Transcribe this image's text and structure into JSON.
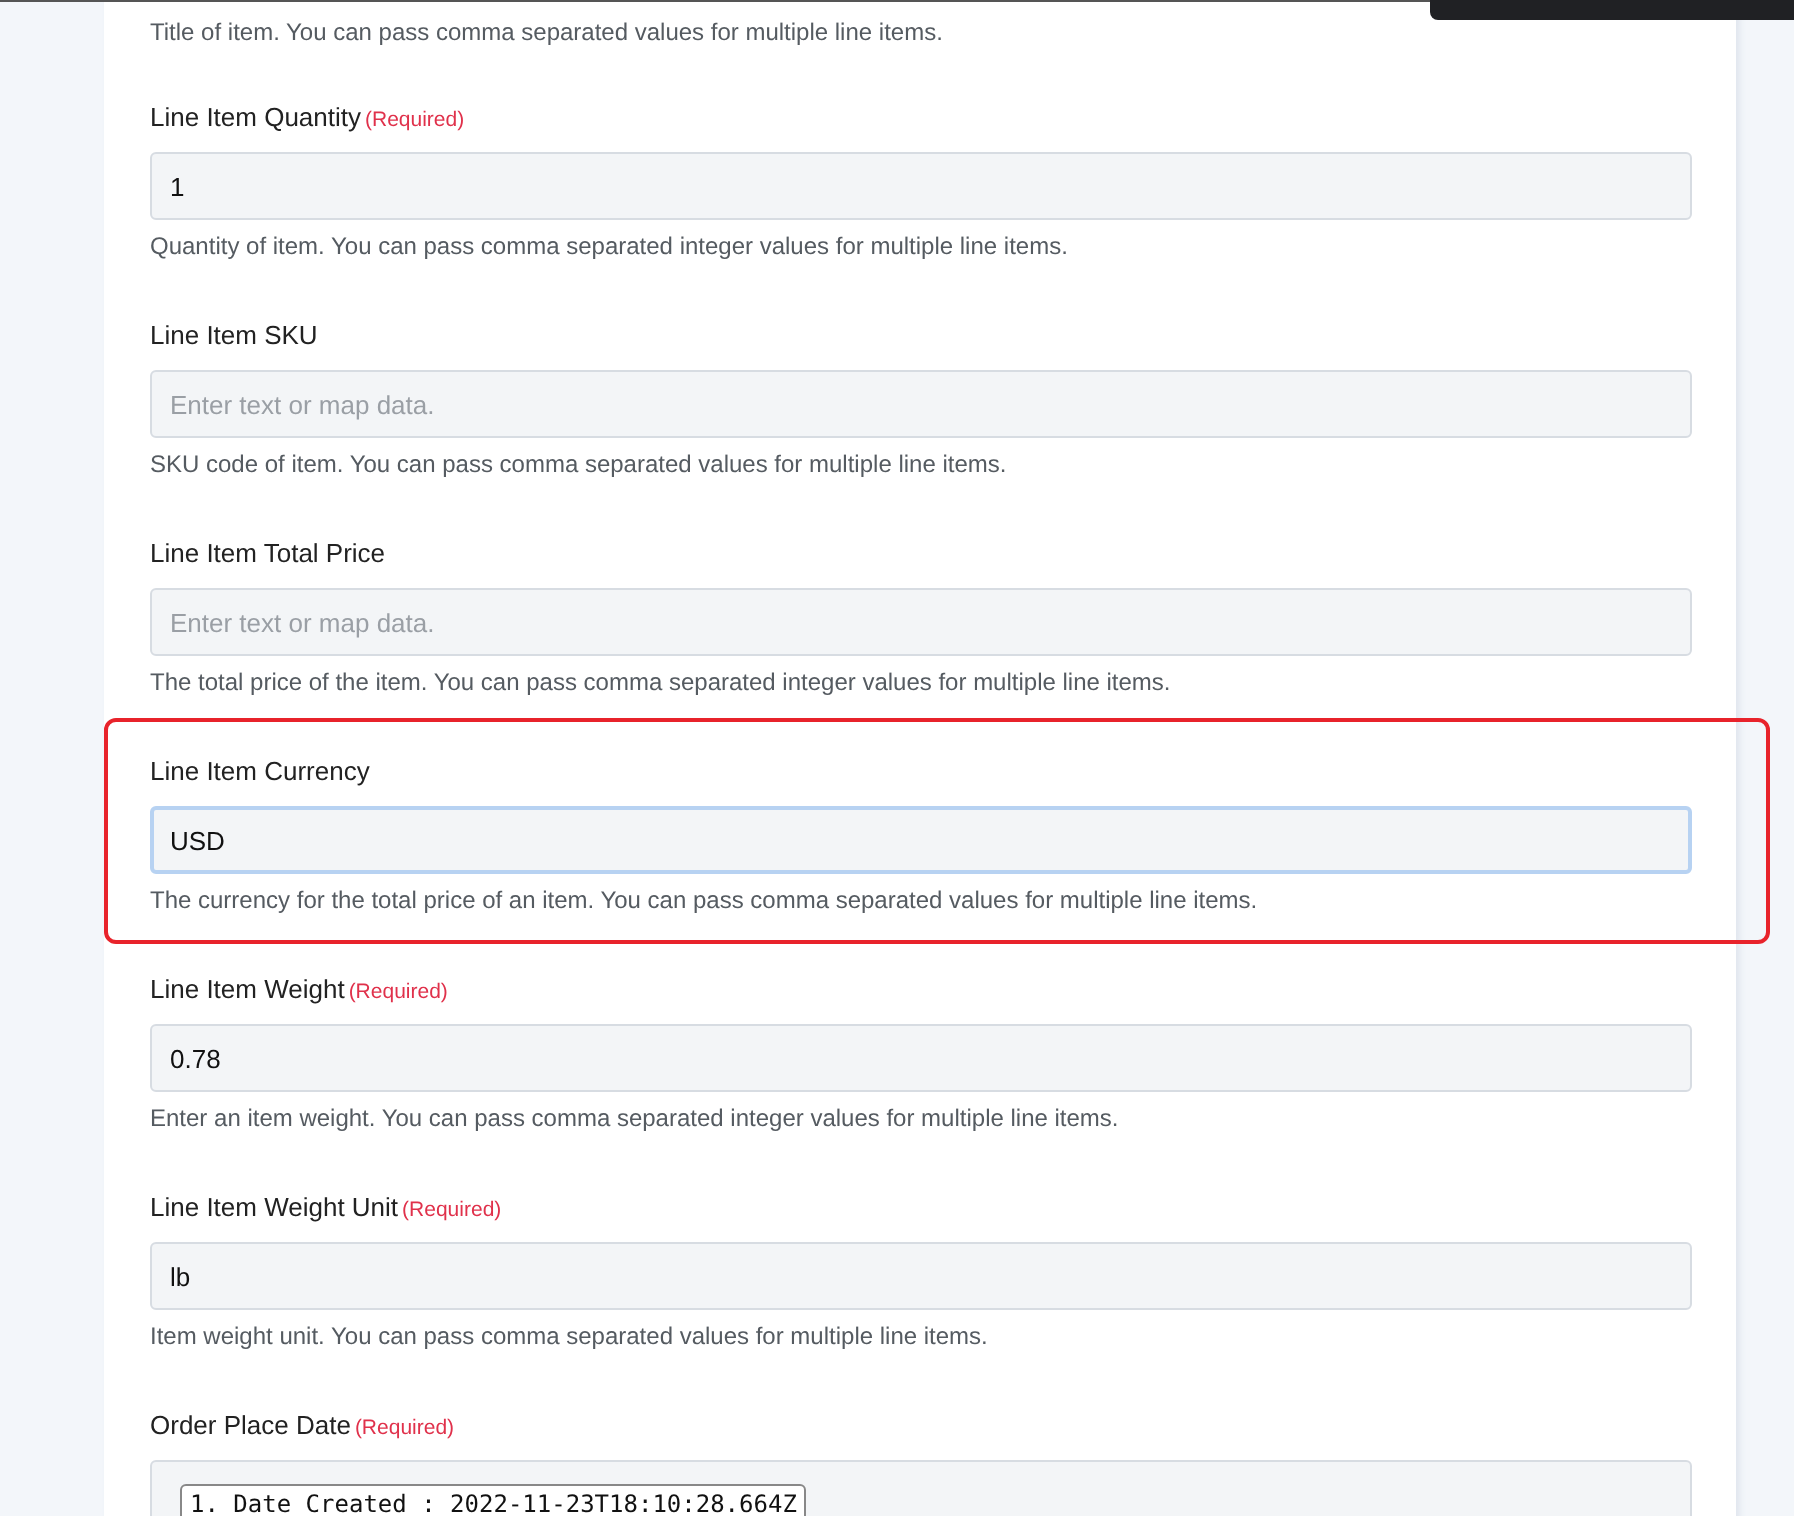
{
  "fields": [
    {
      "kind": "hint",
      "description": "Title of item. You can pass comma separated values for multiple line items."
    },
    {
      "kind": "text",
      "label": "Line Item Quantity",
      "required_note": "(Required)",
      "value": "1",
      "description": "Quantity of item. You can pass comma separated integer values for multiple line items.",
      "highlighted": false,
      "focused": false
    },
    {
      "kind": "text",
      "label": "Line Item SKU",
      "placeholder": "Enter text or map data.",
      "description": "SKU code of item. You can pass comma separated values for multiple line items.",
      "highlighted": false,
      "focused": false
    },
    {
      "kind": "text",
      "label": "Line Item Total Price",
      "placeholder": "Enter text or map data.",
      "description": "The total price of the item. You can pass comma separated integer values for multiple line items.",
      "highlighted": false,
      "focused": false
    },
    {
      "kind": "text",
      "label": "Line Item Currency",
      "value": "USD",
      "description": "The currency for the total price of an item. You can pass comma separated values for multiple line items.",
      "highlighted": true,
      "focused": true
    },
    {
      "kind": "text",
      "label": "Line Item Weight",
      "required_note": "(Required)",
      "value": "0.78",
      "description": "Enter an item weight. You can pass comma separated integer values for multiple line items.",
      "highlighted": false,
      "focused": false
    },
    {
      "kind": "text",
      "label": "Line Item Weight Unit",
      "required_note": "(Required)",
      "value": "lb",
      "description": "Item weight unit. You can pass comma separated values for multiple line items.",
      "highlighted": false,
      "focused": false
    },
    {
      "kind": "tags",
      "label": "Order Place Date",
      "required_note": "(Required)",
      "tags": [
        "1. Date Created : 2022-11-23T18:10:28.664Z"
      ],
      "highlighted": false,
      "focused": false
    }
  ]
}
